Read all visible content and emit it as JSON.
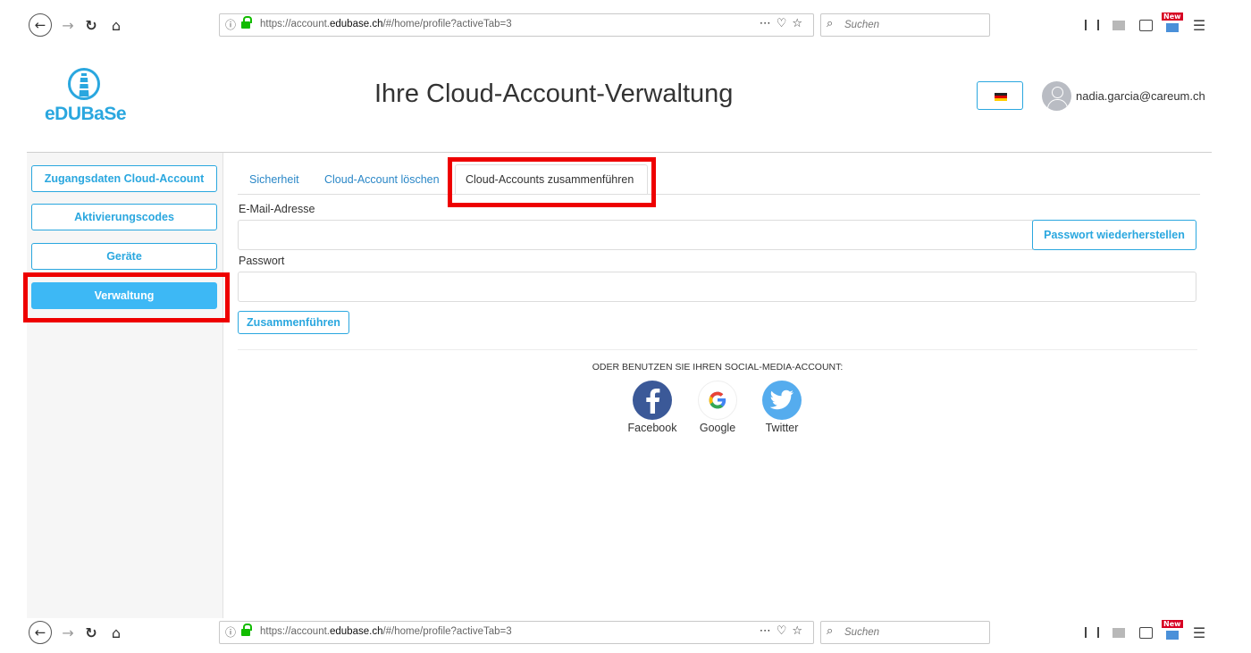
{
  "browser": {
    "url_prefix": "https://account.",
    "url_domain": "edubase.ch",
    "url_suffix": "/#/home/profile?activeTab=3",
    "search_placeholder": "Suchen",
    "new_badge": "New",
    "icons": [
      "back-icon",
      "forward-icon",
      "reload-icon",
      "home-icon",
      "info-icon",
      "lock-icon",
      "more-icon",
      "pocket-icon",
      "bookmark-star-icon",
      "search-icon",
      "library-icon",
      "reader-icon",
      "sidebar-toggle-icon",
      "screenshot-icon",
      "menu-icon"
    ]
  },
  "header": {
    "logo_text": "eDUBaSe",
    "title": "Ihre Cloud-Account-Verwaltung",
    "user_email": "nadia.garcia@careum.ch",
    "language_flag": "german-flag-icon"
  },
  "sidebar": {
    "items": [
      {
        "label": "Zugangsdaten Cloud-Account",
        "active": false
      },
      {
        "label": "Aktivierungscodes",
        "active": false
      },
      {
        "label": "Geräte",
        "active": false
      },
      {
        "label": "Verwaltung",
        "active": true
      }
    ]
  },
  "tabs": [
    {
      "label": "Sicherheit",
      "active": false
    },
    {
      "label": "Cloud-Account löschen",
      "active": false
    },
    {
      "label": "Cloud-Accounts zusammenführen",
      "active": true
    }
  ],
  "form": {
    "email_label": "E-Mail-Adresse",
    "email_value": "",
    "recover_button": "Passwort wiederherstellen",
    "password_label": "Passwort",
    "password_value": "",
    "merge_button": "Zusammenführen"
  },
  "social": {
    "heading": "ODER BENUTZEN SIE IHREN SOCIAL-MEDIA-ACCOUNT:",
    "providers": [
      {
        "label": "Facebook",
        "icon": "facebook-icon",
        "color": "#3b5998"
      },
      {
        "label": "Google",
        "icon": "google-icon",
        "color": "#ffffff"
      },
      {
        "label": "Twitter",
        "icon": "twitter-icon",
        "color": "#55acee"
      }
    ]
  },
  "colors": {
    "accent": "#2aa7df",
    "active_button": "#3db8f5",
    "highlight": "#ee0000"
  }
}
